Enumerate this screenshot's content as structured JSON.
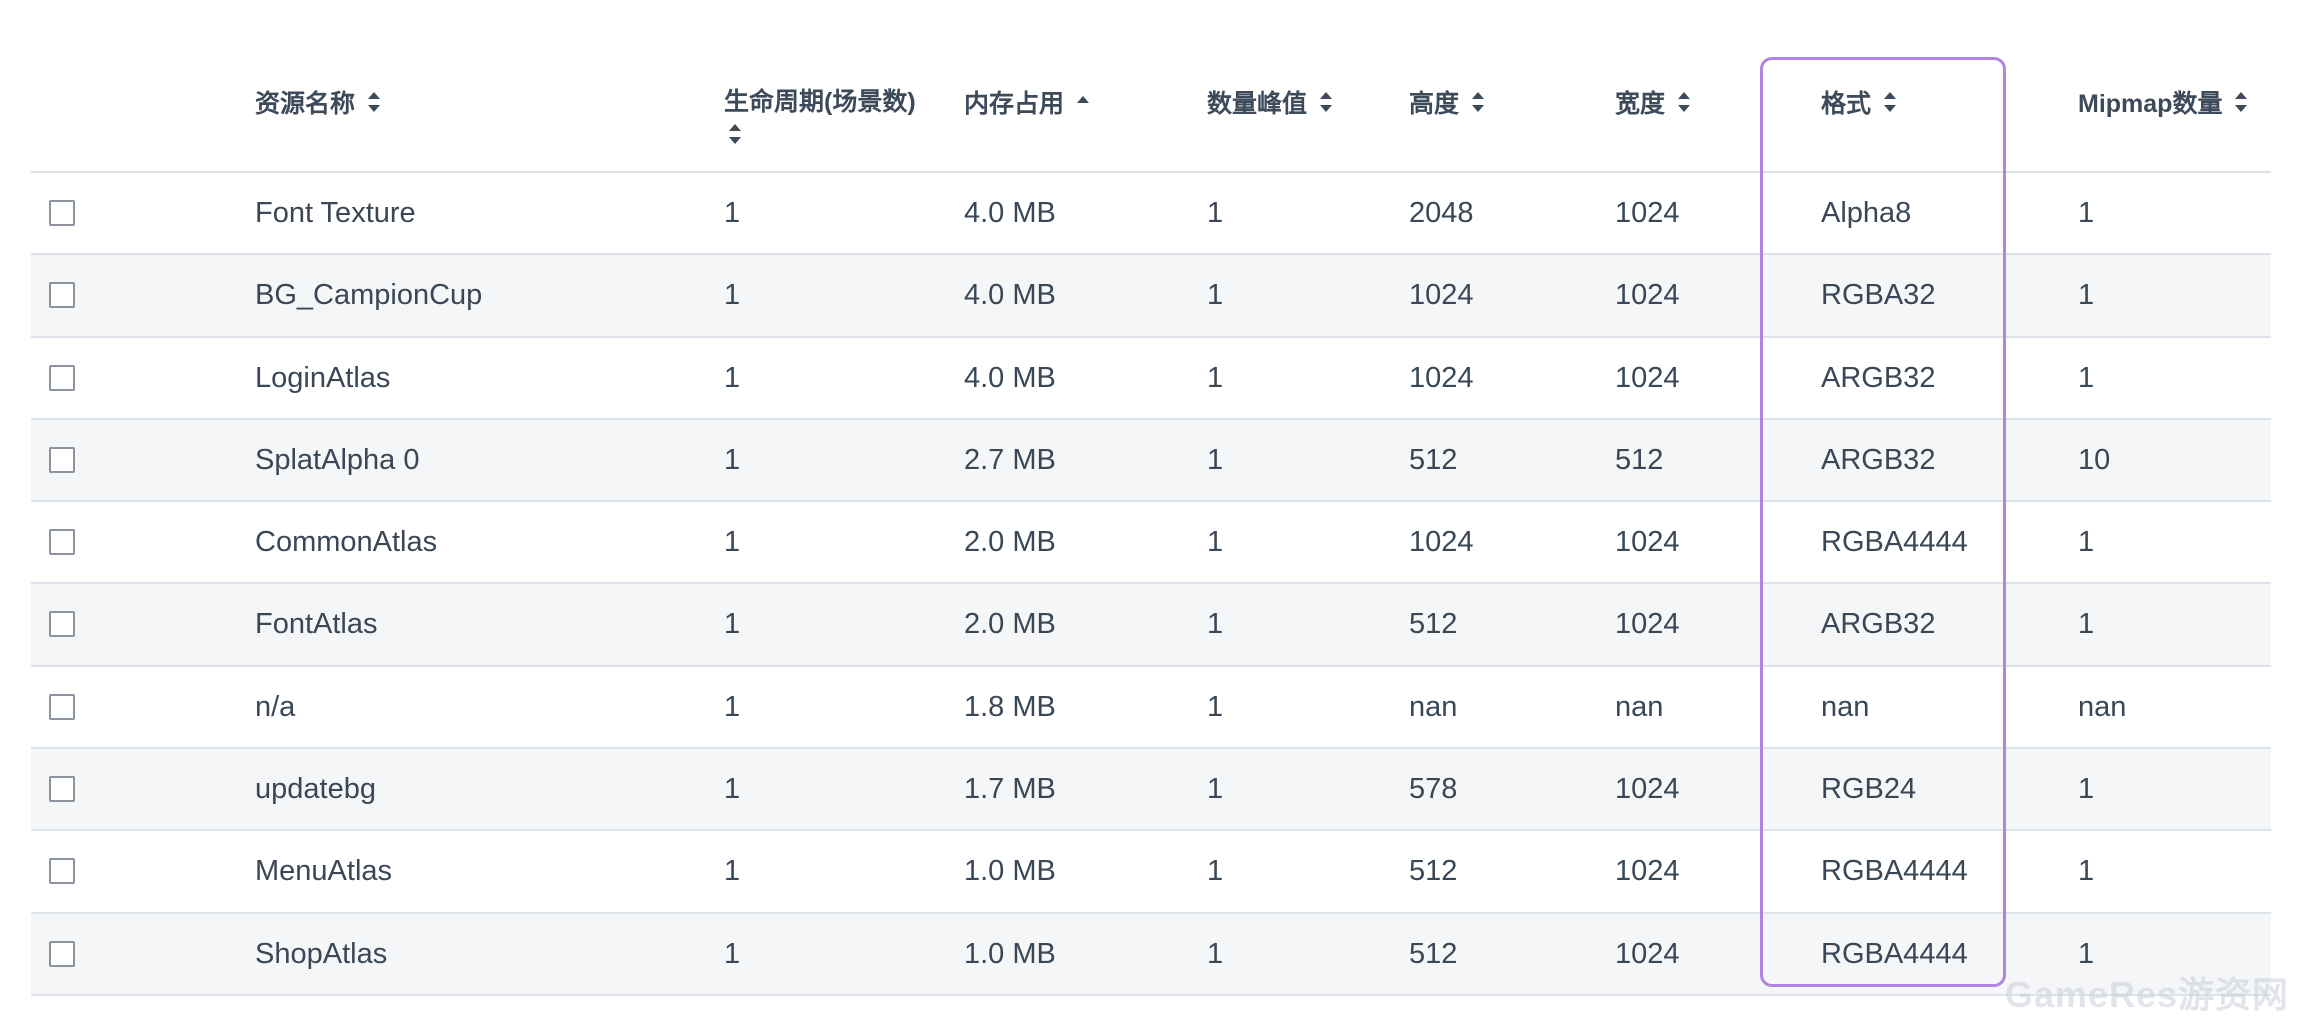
{
  "columns": [
    {
      "label": "资源名称",
      "sort": "both"
    },
    {
      "label": "生命周期(场景数)",
      "sort": "both"
    },
    {
      "label": "内存占用",
      "sort": "asc"
    },
    {
      "label": "数量峰值",
      "sort": "both"
    },
    {
      "label": "高度",
      "sort": "both"
    },
    {
      "label": "宽度",
      "sort": "both"
    },
    {
      "label": "格式",
      "sort": "both"
    },
    {
      "label": "Mipmap数量",
      "sort": "both"
    }
  ],
  "rows": [
    {
      "name": "Font Texture",
      "lifecycle": "1",
      "memory": "4.0 MB",
      "peak": "1",
      "height": "2048",
      "width": "1024",
      "format": "Alpha8",
      "mipmap": "1"
    },
    {
      "name": "BG_CampionCup",
      "lifecycle": "1",
      "memory": "4.0 MB",
      "peak": "1",
      "height": "1024",
      "width": "1024",
      "format": "RGBA32",
      "mipmap": "1"
    },
    {
      "name": "LoginAtlas",
      "lifecycle": "1",
      "memory": "4.0 MB",
      "peak": "1",
      "height": "1024",
      "width": "1024",
      "format": "ARGB32",
      "mipmap": "1"
    },
    {
      "name": "SplatAlpha 0",
      "lifecycle": "1",
      "memory": "2.7 MB",
      "peak": "1",
      "height": "512",
      "width": "512",
      "format": "ARGB32",
      "mipmap": "10"
    },
    {
      "name": "CommonAtlas",
      "lifecycle": "1",
      "memory": "2.0 MB",
      "peak": "1",
      "height": "1024",
      "width": "1024",
      "format": "RGBA4444",
      "mipmap": "1"
    },
    {
      "name": "FontAtlas",
      "lifecycle": "1",
      "memory": "2.0 MB",
      "peak": "1",
      "height": "512",
      "width": "1024",
      "format": "ARGB32",
      "mipmap": "1"
    },
    {
      "name": "n/a",
      "lifecycle": "1",
      "memory": "1.8 MB",
      "peak": "1",
      "height": "nan",
      "width": "nan",
      "format": "nan",
      "mipmap": "nan"
    },
    {
      "name": "updatebg",
      "lifecycle": "1",
      "memory": "1.7 MB",
      "peak": "1",
      "height": "578",
      "width": "1024",
      "format": "RGB24",
      "mipmap": "1"
    },
    {
      "name": "MenuAtlas",
      "lifecycle": "1",
      "memory": "1.0 MB",
      "peak": "1",
      "height": "512",
      "width": "1024",
      "format": "RGBA4444",
      "mipmap": "1"
    },
    {
      "name": "ShopAtlas",
      "lifecycle": "1",
      "memory": "1.0 MB",
      "peak": "1",
      "height": "512",
      "width": "1024",
      "format": "RGBA4444",
      "mipmap": "1"
    }
  ],
  "watermark": "GameRes游资网",
  "colors": {
    "highlight": "#b084e0",
    "row_alt": "#f5f6f8",
    "border": "#dde3ea"
  }
}
